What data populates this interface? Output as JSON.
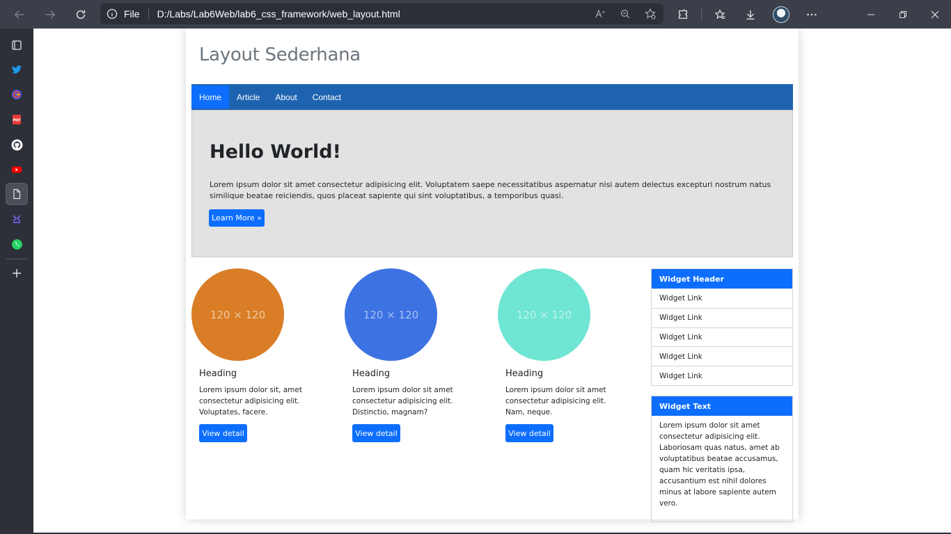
{
  "browser": {
    "address": {
      "scheme": "File",
      "url": "D:/Labs/Lab6Web/lab6_css_framework/web_layout.html"
    }
  },
  "page": {
    "title": "Layout Sederhana",
    "nav": [
      "Home",
      "Article",
      "About",
      "Contact"
    ],
    "hero": {
      "heading": "Hello World!",
      "text": "Lorem ipsum dolor sit amet consectetur adipisicing elit. Voluptatem saepe necessitatibus aspernatur nisi autem delectus excepturi nostrum natus similique beatae reiciendis, quos placeat sapiente qui sint voluptatibus, a temporibus quasi.",
      "button": "Learn More »"
    },
    "cards": [
      {
        "image_label": "120 × 120",
        "color": "#d97e26",
        "heading": "Heading",
        "text": "Lorem ipsum dolor sit, amet consectetur adipisicing elit. Voluptates, facere.",
        "button": "View detail"
      },
      {
        "image_label": "120 × 120",
        "color": "#3d72e3",
        "heading": "Heading",
        "text": "Lorem ipsum dolor sit amet consectetur adipisicing elit. Distinctio, magnam?",
        "button": "View detail"
      },
      {
        "image_label": "120 × 120",
        "color": "#6fe5d3",
        "heading": "Heading",
        "text": "Lorem ipsum dolor sit amet consectetur adipisicing elit. Nam, neque.",
        "button": "View detail"
      }
    ],
    "widget_links": {
      "header": "Widget Header",
      "links": [
        "Widget Link",
        "Widget Link",
        "Widget Link",
        "Widget Link",
        "Widget Link"
      ]
    },
    "widget_text": {
      "header": "Widget Text",
      "text": "Lorem ipsum dolor sit amet consectetur adipisicing elit. Laboriosam quas natus, amet ab voluptatibus beatae accusamus, quam hic veritatis ipsa, accusantium est nihil dolores minus at labore sapiente autem vero."
    }
  },
  "sidebar_icons": [
    "tabs-icon",
    "twitter-icon",
    "google-icon",
    "pdf-icon",
    "github-icon",
    "youtube-icon",
    "page-icon",
    "app-icon",
    "whatsapp-icon",
    "add-icon"
  ],
  "colors": {
    "primary": "#0d6efd",
    "navbar": "#1e63b0",
    "hero_bg": "#e2e2e2",
    "chrome": "#3b3f4a",
    "sidebar": "#2d3038"
  }
}
